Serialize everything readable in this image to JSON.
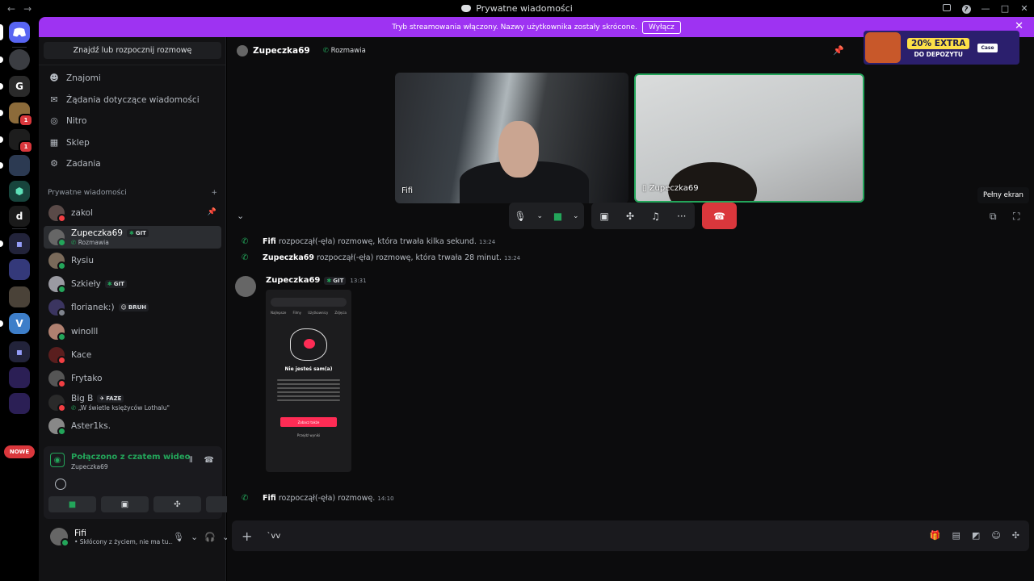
{
  "window": {
    "title": "Prywatne wiadomości",
    "back": "←",
    "forward": "→"
  },
  "banner": {
    "text": "Tryb streamowania włączony. Nazwy użytkownika zostały skrócone.",
    "button": "Wyłącz"
  },
  "rail": {
    "letter_server": "d",
    "new_badge": "NOWE",
    "badge_1": "1",
    "badge_2": "1"
  },
  "sidebar": {
    "search": "Znajdź lub rozpocznij rozmowę",
    "menu": [
      {
        "label": "Znajomi",
        "icon": "friends-icon"
      },
      {
        "label": "Żądania dotyczące wiadomości",
        "icon": "mail-icon"
      },
      {
        "label": "Nitro",
        "icon": "nitro-icon"
      },
      {
        "label": "Sklep",
        "icon": "shop-icon"
      },
      {
        "label": "Zadania",
        "icon": "quests-icon"
      }
    ],
    "dm_header": "Prywatne wiadomości",
    "dms": [
      {
        "name": "zakol",
        "tag": "",
        "sub": "",
        "status": "dnd"
      },
      {
        "name": "Zupeczka69",
        "tag": "GIT",
        "sub": "Rozmawia",
        "status": "on"
      },
      {
        "name": "Rysiu",
        "tag": "",
        "sub": "",
        "status": "on"
      },
      {
        "name": "Szkiełу",
        "tag": "GIT",
        "sub": "",
        "status": "on"
      },
      {
        "name": "florianek:)",
        "tag": "BRUH",
        "sub": "",
        "status": "off"
      },
      {
        "name": "winolll",
        "tag": "",
        "sub": "",
        "status": "on"
      },
      {
        "name": "Kace",
        "tag": "",
        "sub": "",
        "status": "dnd"
      },
      {
        "name": "Frytako",
        "tag": "",
        "sub": "",
        "status": "dnd"
      },
      {
        "name": "Big B",
        "tag": "FAZE",
        "sub": "„W świetle księżyców Lothalu\"",
        "status": "dnd"
      },
      {
        "name": "Aster1ks.",
        "tag": "",
        "sub": "",
        "status": "on"
      }
    ]
  },
  "voice_panel": {
    "title": "Połączono z czatem wideo",
    "subtitle": "Zupeczka69"
  },
  "user_panel": {
    "name": "Fifi",
    "status": "• Skłócony z życiem, nie ma tu..."
  },
  "main": {
    "header_name": "Zupeczka69",
    "header_status": "Rozmawia",
    "ad": {
      "line1": "20% EXTRA",
      "line2": "DO DEPOZYTU",
      "brand": "Case"
    },
    "tiles": [
      {
        "label": "Fifi"
      },
      {
        "label": "Zupeczka69"
      }
    ],
    "tooltip": "Pełny ekran",
    "messages": [
      {
        "user": "Fifi",
        "text": "rozpoczął(-ęła) rozmowę, która trwała kilka sekund.",
        "time": "13:24"
      },
      {
        "user": "Zupeczka69",
        "text": "rozpoczął(-ęła) rozmowę, która trwała 28 minut.",
        "time": "13:24"
      }
    ],
    "post": {
      "user": "Zupeczka69",
      "tag": "GIT",
      "time": "13:31"
    },
    "phone": {
      "tabs": [
        "Najlepsze",
        "Filmy",
        "Użytkownicy",
        "Zdjęcia"
      ],
      "title": "Nie jesteś sam(a)",
      "button": "Zobacz także",
      "link": "Przejdź wyniki"
    },
    "last_message": {
      "user": "Fifi",
      "text": "rozpoczął(-ęła) rozmowę.",
      "time": "14:10"
    },
    "composer_text": "`vv"
  },
  "colors": {
    "accent": "#5865f2",
    "banner": "#9e33f2",
    "online": "#23a55a",
    "danger": "#da373c"
  }
}
